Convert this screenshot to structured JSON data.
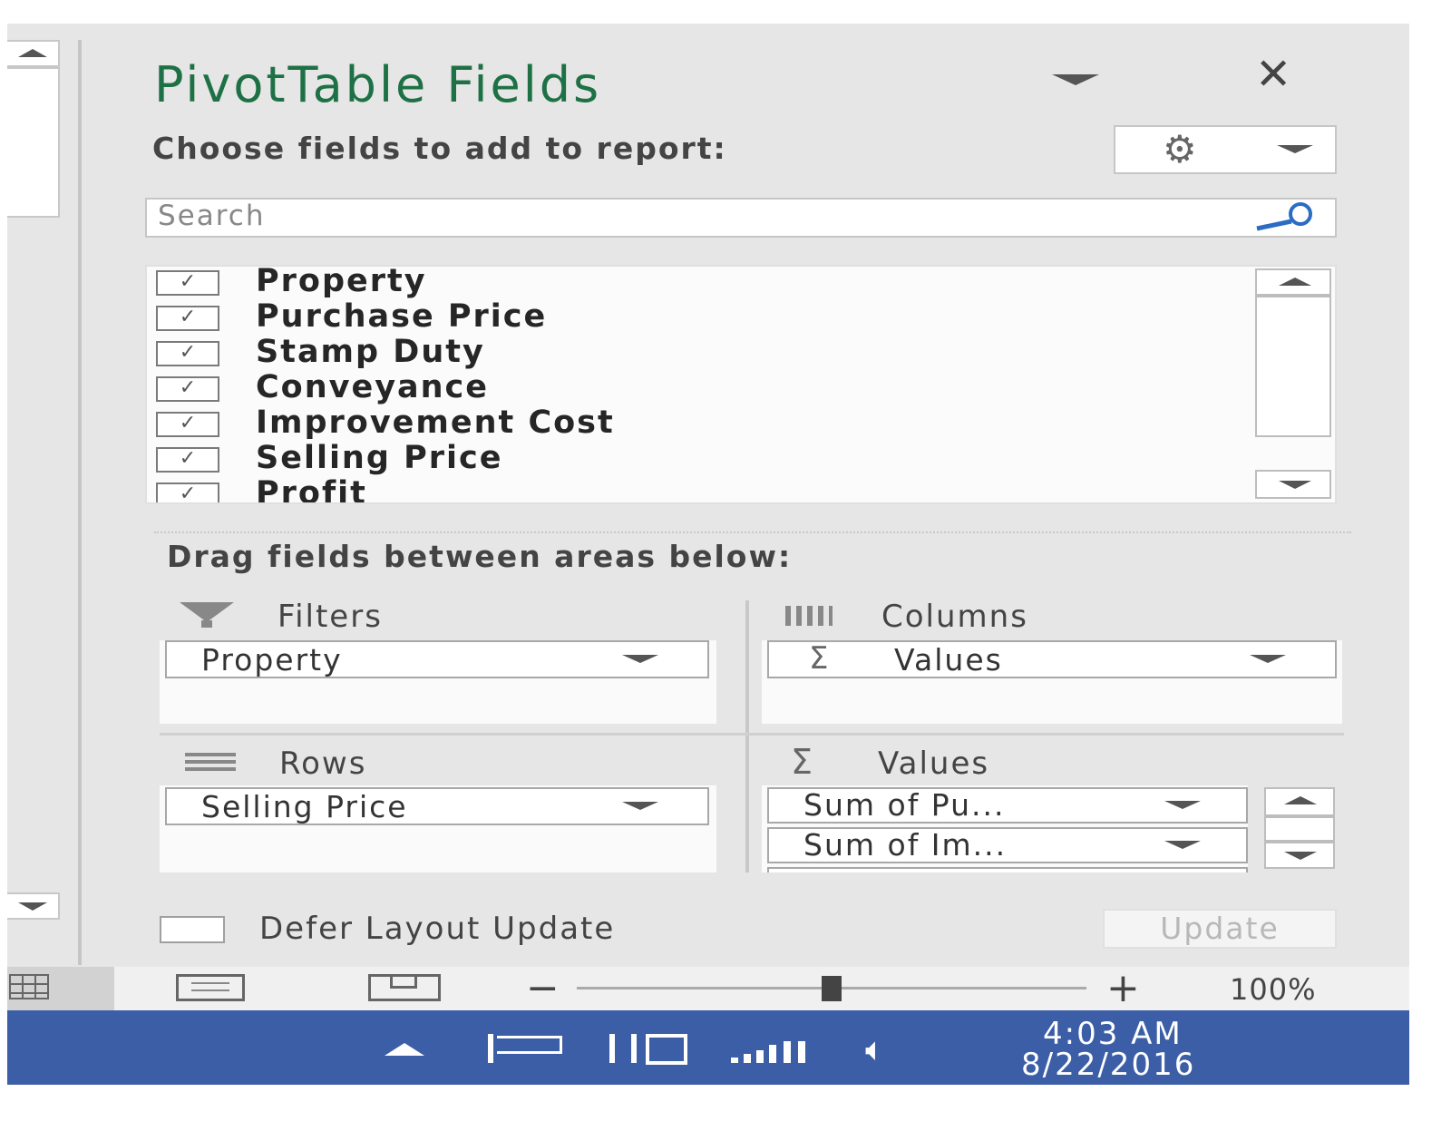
{
  "pane": {
    "title": "PivotTable Fields",
    "close_glyph": "✕",
    "choose_label": "Choose fields to add to report:",
    "search_placeholder": "Search",
    "fields": [
      {
        "label": "Property",
        "checked": true
      },
      {
        "label": "Purchase Price",
        "checked": true
      },
      {
        "label": "Stamp Duty",
        "checked": true
      },
      {
        "label": "Conveyance",
        "checked": true
      },
      {
        "label": "Improvement Cost",
        "checked": true
      },
      {
        "label": "Selling Price",
        "checked": true
      },
      {
        "label": "Profit",
        "checked": true
      }
    ],
    "drag_label": "Drag fields between areas below:",
    "areas": {
      "filters": {
        "label": "Filters",
        "items": [
          "Property"
        ]
      },
      "columns": {
        "label": "Columns",
        "items": [
          "Values"
        ],
        "sigma": "Σ"
      },
      "rows": {
        "label": "Rows",
        "items": [
          "Selling Price"
        ]
      },
      "values": {
        "label": "Values",
        "sigma": "Σ",
        "items": [
          "Sum of Pu...",
          "Sum of Im..."
        ]
      }
    },
    "defer_label": "Defer Layout Update",
    "update_label": "Update"
  },
  "status_bar": {
    "zoom_out": "−",
    "zoom_in": "+",
    "zoom_level": "100%"
  },
  "taskbar": {
    "time": "4:03 AM",
    "date": "8/22/2016"
  },
  "colors": {
    "title": "#1e7145",
    "taskbar": "#3b5ea6",
    "pane_bg": "#e6e6e6"
  },
  "icons": [
    "close-icon",
    "gear-icon",
    "search-icon",
    "filter-icon",
    "columns-icon",
    "rows-icon",
    "sigma-icon",
    "flag-icon",
    "battery-icon",
    "network-icon",
    "volume-icon"
  ]
}
